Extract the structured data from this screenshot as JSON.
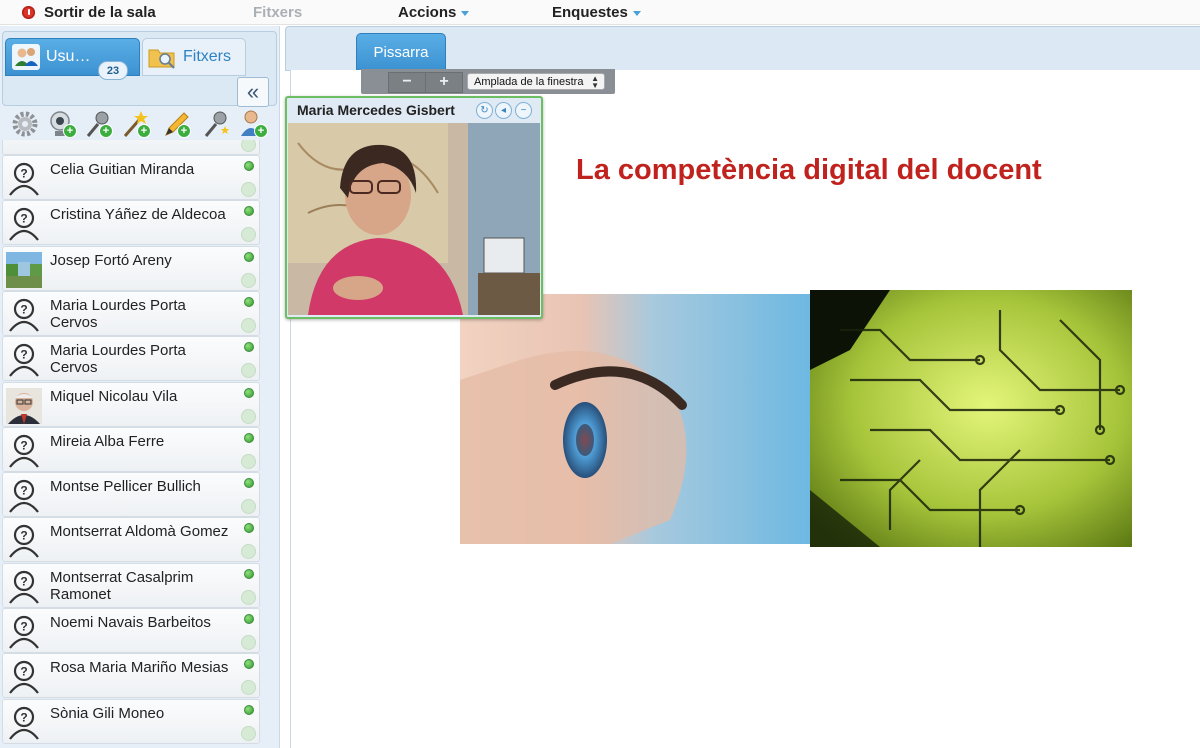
{
  "topbar": {
    "exit_label": "Sortir de la sala",
    "menu_files": "Fitxers",
    "menu_actions": "Accions",
    "menu_polls": "Enquestes"
  },
  "left_panel": {
    "tab_users_label": "Usu…",
    "tab_users_count": "23",
    "tab_files_label": "Fitxers",
    "collapse_icon": "«",
    "toolbar_icons": [
      "gear-icon",
      "add-webcam-icon",
      "add-microphone-icon",
      "add-wand-icon",
      "add-pencil-icon",
      "microphone-star-icon",
      "add-user-icon"
    ]
  },
  "users": [
    {
      "name": "Celia Guitian Miranda",
      "avatar": "placeholder"
    },
    {
      "name": "Cristina Yáñez de Aldecoa",
      "avatar": "placeholder"
    },
    {
      "name": "Josep Fortó Areny",
      "avatar": "landscape"
    },
    {
      "name": "Maria Lourdes Porta Cervos",
      "avatar": "placeholder"
    },
    {
      "name": "Maria Lourdes Porta Cervos",
      "avatar": "placeholder"
    },
    {
      "name": "Miquel Nicolau Vila",
      "avatar": "photo"
    },
    {
      "name": "Mireia Alba Ferre",
      "avatar": "placeholder"
    },
    {
      "name": "Montse Pellicer Bullich",
      "avatar": "placeholder"
    },
    {
      "name": "Montserrat Aldomà Gomez",
      "avatar": "placeholder"
    },
    {
      "name": "Montserrat Casalprim Ramonet",
      "avatar": "placeholder"
    },
    {
      "name": "Noemi Navais Barbeitos",
      "avatar": "placeholder"
    },
    {
      "name": "Rosa Maria Mariño Mesias",
      "avatar": "placeholder"
    },
    {
      "name": "Sònia Gili Moneo",
      "avatar": "placeholder"
    }
  ],
  "main": {
    "tab_whiteboard": "Pissarra",
    "zoom_out": "−",
    "zoom_in": "+",
    "zoom_select": "Amplada de la finestra",
    "slide_title": "La competència digital del docent"
  },
  "video_pod": {
    "title": "Maria Mercedes Gisbert",
    "buttons": [
      "refresh-icon",
      "speaker-icon",
      "minimize-icon"
    ],
    "refresh_glyph": "↻",
    "speaker_glyph": "◂",
    "minimize_glyph": "−"
  },
  "colors": {
    "accent": "#3c92d1",
    "slide_title": "#c0231e",
    "online": "#2f9a2f"
  }
}
